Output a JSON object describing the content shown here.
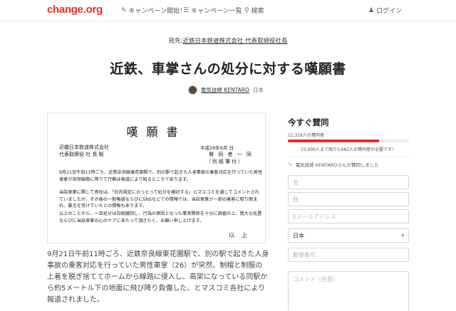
{
  "header": {
    "logo": "change.org",
    "nav": {
      "start": "キャンペーン開始！",
      "browse": "キャンペーン一覧",
      "search": "検索",
      "login": "ログイン"
    },
    "icons": {
      "start": "pencil-icon",
      "browse": "list-icon",
      "search": "search-icon",
      "login": "user-icon"
    }
  },
  "petition": {
    "recipient_prefix": "宛先:",
    "recipient": "近鉄日本鉄道株式会社 代表取締役社長",
    "title": "近鉄、車掌さんの処分に対する嘆願書",
    "author_name": "電気技師 KENTARO",
    "author_country": "日本"
  },
  "doc": {
    "title": "嘆願書",
    "to_line1": "近畿日本鉄道株式会社",
    "to_line2": "代表取締役 社 長 殿",
    "date": "平成28年9月 日",
    "sign1": "賛 同 者 一 同",
    "sign2": "（別紙署付）",
    "para1": "9月21日午前11時ごろ、近鉄奈良線東花園駅で、別の駅で起きた人身事故の乗客対応を行っていた男性車掌が突然線路に降りて行動は報道により知るところであります。",
    "para2": "当該車掌に関して貴社は、「社内規定にのっとって処分を検討する」とマスコミを通じてコメントされていましたが、その後の一般報道ならびにSNSなどでの情報では、当該車掌が一部の乗客に取り囲まれ、暴言を受けていたとの情報もあります。",
    "para3": "以上のことから、一旦処分は白紙撤回し、行為の原因となった事実関係を十分に調査の上、寛大な処置ならびに当該車掌の心のケアにあたって頂きたく、お願い申し上げます。",
    "end": "以上"
  },
  "body": {
    "text": "9月21日午前11時ごろ、近鉄奈良線東花園駅で、別の駅で起きた人身事故の乗客対応を行っていた男性車掌（26）が突然、制帽と制服の上着を脱ぎ捨ててホームから線路に侵入し、高架になっている同駅から約5メートル下の地面に飛び降り負傷した、とマスコミ各社により報道されました。"
  },
  "sidebar": {
    "title": "今すぐ賛同",
    "count": "11,318人の賛同者",
    "progress": 0.75,
    "goal": "15,000人まで残り3,682人の賛同者が必要です！",
    "recent": "電気技師 KENTAROさんが賛同しました",
    "recent_icon": "pencil-icon",
    "form": {
      "first_name_placeholder": "名",
      "last_name_placeholder": "姓",
      "email_placeholder": "Eメールアドレス",
      "country": "日本",
      "zip_placeholder": "郵便番号",
      "reason_placeholder": "コメント（任意）"
    }
  },
  "colors": {
    "brand": "#ec2c22",
    "text": "#333333"
  }
}
